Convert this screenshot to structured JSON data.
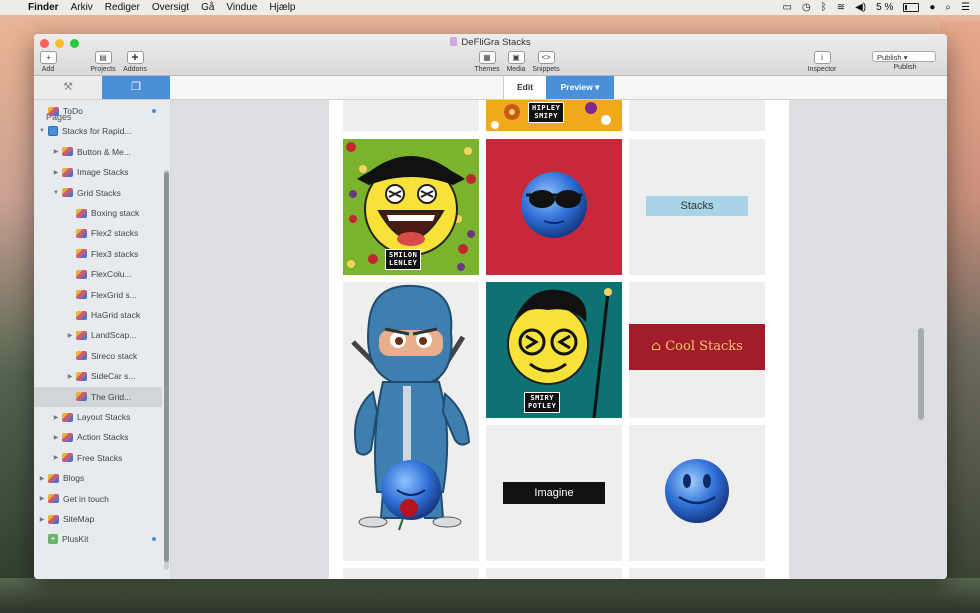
{
  "menubar": {
    "apple": "",
    "items": [
      "Finder",
      "Arkiv",
      "Rediger",
      "Oversigt",
      "Gå",
      "Vindue",
      "Hjælp"
    ],
    "battery": "5 %"
  },
  "window": {
    "title": "DeFliGra Stacks",
    "toolbar": {
      "add": "Add",
      "projects": "Projects",
      "addons": "Addons",
      "themes": "Themes",
      "media": "Media",
      "snippets": "Snippets",
      "inspector": "Inspector",
      "publish_button": "Publish",
      "publish_label": "Publish"
    },
    "tabs": {
      "edit": "Edit",
      "preview": "Preview"
    }
  },
  "sidebar": {
    "header": "Pages",
    "items": [
      {
        "label": "ToDo",
        "indent": 0,
        "icon": "stacks-icon",
        "dot": true
      },
      {
        "label": "Stacks for Rapid...",
        "indent": 0,
        "icon": "site-icon",
        "expanded": true
      },
      {
        "label": "Button & Me...",
        "indent": 1,
        "icon": "stacks-icon",
        "collapsed": true
      },
      {
        "label": "Image Stacks",
        "indent": 1,
        "icon": "stacks-icon",
        "collapsed": true
      },
      {
        "label": "Grid Stacks",
        "indent": 1,
        "icon": "stacks-icon",
        "expanded": true
      },
      {
        "label": "Boxing stack",
        "indent": 2,
        "icon": "stacks-icon"
      },
      {
        "label": "Flex2 stacks",
        "indent": 2,
        "icon": "stacks-icon"
      },
      {
        "label": "Flex3 stacks",
        "indent": 2,
        "icon": "stacks-icon"
      },
      {
        "label": "FlexColu...",
        "indent": 2,
        "icon": "stacks-icon"
      },
      {
        "label": "FlexGrid s...",
        "indent": 2,
        "icon": "stacks-icon"
      },
      {
        "label": "HaGrid stack",
        "indent": 2,
        "icon": "stacks-icon"
      },
      {
        "label": "LandScap...",
        "indent": 2,
        "icon": "stacks-icon",
        "collapsed": true
      },
      {
        "label": "Sireco stack",
        "indent": 2,
        "icon": "stacks-icon"
      },
      {
        "label": "SideCar s...",
        "indent": 2,
        "icon": "stacks-icon",
        "collapsed": true
      },
      {
        "label": "The Grid...",
        "indent": 2,
        "icon": "stacks-icon",
        "selected": true
      },
      {
        "label": "Layout Stacks",
        "indent": 1,
        "icon": "stacks-icon",
        "collapsed": true
      },
      {
        "label": "Action Stacks",
        "indent": 1,
        "icon": "stacks-icon",
        "collapsed": true
      },
      {
        "label": "Free Stacks",
        "indent": 1,
        "icon": "stacks-icon",
        "collapsed": true
      },
      {
        "label": "Blogs",
        "indent": 0,
        "icon": "stacks-icon",
        "collapsed": true
      },
      {
        "label": "Get in touch",
        "indent": 0,
        "icon": "stacks-icon",
        "collapsed": true
      },
      {
        "label": "SiteMap",
        "indent": 0,
        "icon": "stacks-icon",
        "collapsed": true
      },
      {
        "label": "PlusKit",
        "indent": 0,
        "icon": "pluskit-icon",
        "dot": true
      }
    ]
  },
  "preview": {
    "hipley_tag": [
      "HIPLEY",
      "SMIPY"
    ],
    "smilon_tag": [
      "SMILON",
      "LENLEY"
    ],
    "smiry_tag": [
      "SMIRY",
      "POTLEY"
    ],
    "stacks_button": "Stacks",
    "cool_button": "⌂ Cool Stacks",
    "imagine_button": "Imagine"
  },
  "colors": {
    "accent": "#4a90d9",
    "cool_bg": "#a31c2c",
    "cool_text": "#f2c76b",
    "stacks_bg": "#a9d3e7",
    "red_cell": "#c8283a",
    "teal_cell": "#0f7272"
  }
}
